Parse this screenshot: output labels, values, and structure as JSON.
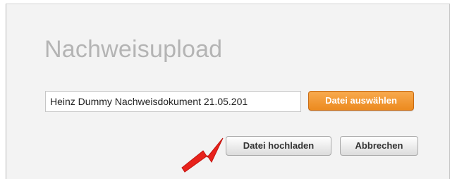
{
  "dialog": {
    "title": "Nachweisupload",
    "file_input": {
      "value": "Heinz Dummy Nachweisdokument 21.05.201"
    },
    "buttons": {
      "choose_file_label": "Datei auswählen",
      "upload_label": "Datei hochladen",
      "cancel_label": "Abbrechen"
    }
  },
  "annotation": {
    "arrow_icon": "red-arrow-icon",
    "arrow_color": "#e8221c"
  },
  "colors": {
    "accent_orange": "#ee8e24",
    "title_gray": "#b4b4b4",
    "panel_bg": "#f3f3f3"
  }
}
